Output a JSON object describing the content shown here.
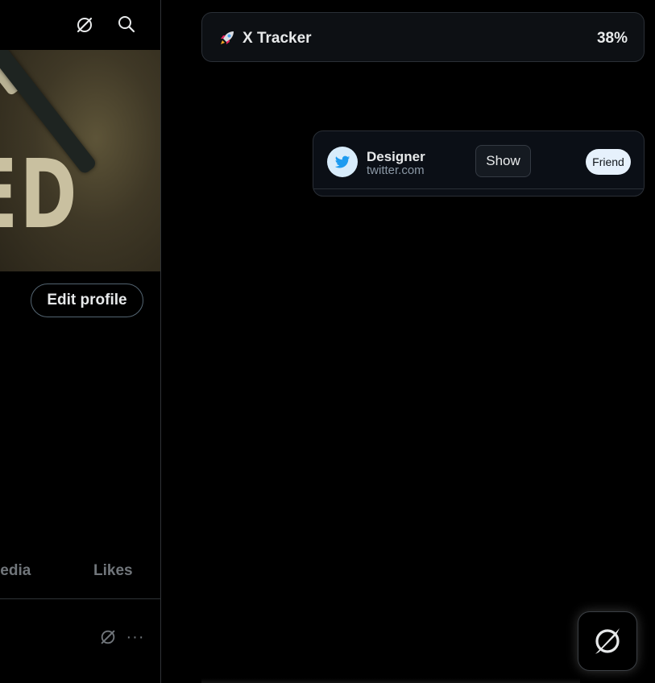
{
  "left": {
    "banner_text": "ED",
    "edit_profile_label": "Edit profile",
    "tabs": [
      {
        "label": "ledia"
      },
      {
        "label": "Likes"
      }
    ],
    "more_label": "···"
  },
  "tracker": {
    "title": "X Tracker",
    "percent": "38%"
  },
  "card": {
    "name": "Designer",
    "domain": "twitter.com",
    "show_label": "Show",
    "badge": "Friend"
  },
  "icons": {
    "extension": "no-signal-slash-icon",
    "search": "search-icon",
    "rocket": "rocket-icon",
    "twitter": "twitter-bird-icon",
    "more": "more-dots-icon"
  },
  "colors": {
    "background": "#000000",
    "text": "#e7e9ea",
    "muted": "#71767b",
    "twitter_blue": "#1d9bf0",
    "badge_bg": "#e6f1fc"
  }
}
